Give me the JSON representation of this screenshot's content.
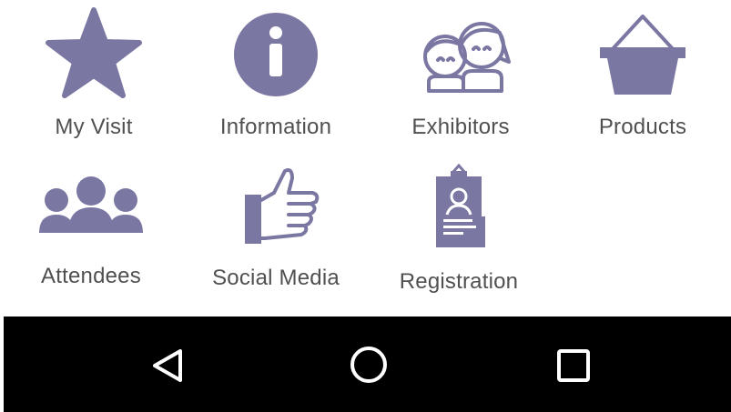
{
  "theme": {
    "icon_color": "#7b77a3",
    "label_color": "#505050",
    "nav_bg": "#000000",
    "nav_icon_color": "#ffffff"
  },
  "menu": {
    "items": [
      {
        "label": "My Visit",
        "icon": "star-icon"
      },
      {
        "label": "Information",
        "icon": "info-icon"
      },
      {
        "label": "Exhibitors",
        "icon": "people-pair-icon"
      },
      {
        "label": "Products",
        "icon": "basket-icon"
      },
      {
        "label": "Attendees",
        "icon": "group-icon"
      },
      {
        "label": "Social Media",
        "icon": "thumbs-up-icon"
      },
      {
        "label": "Registration",
        "icon": "badge-icon"
      }
    ]
  },
  "navbar": {
    "buttons": [
      {
        "icon": "back-triangle-icon"
      },
      {
        "icon": "home-circle-icon"
      },
      {
        "icon": "recents-square-icon"
      }
    ]
  }
}
